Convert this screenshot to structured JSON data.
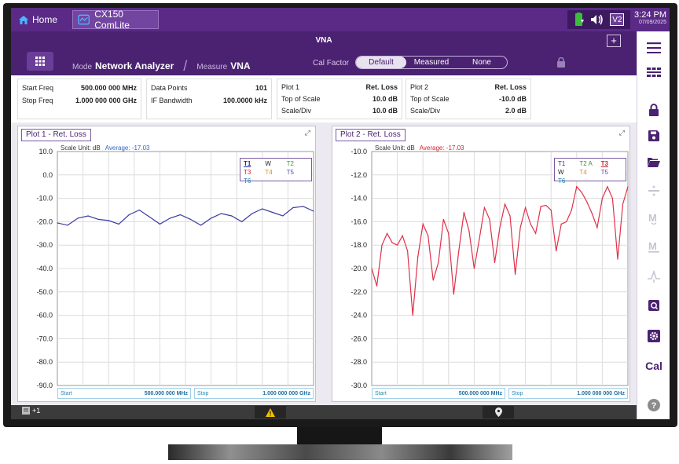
{
  "topbar": {
    "home_label": "Home",
    "app_tab_label": "CX150 ComLite",
    "status_v2": "V2",
    "time": "3:24 PM",
    "date": "07/09/2025"
  },
  "header": {
    "title": "VNA",
    "plus": "+",
    "mode_label": "Mode",
    "mode_value": "Network Analyzer",
    "measure_label": "Measure",
    "measure_value": "VNA",
    "cal_factor_label": "Cal Factor",
    "cal_options": [
      "Default",
      "Measured",
      "None"
    ],
    "cal_selected": "Default"
  },
  "info": {
    "freq": [
      {
        "label": "Start Freq",
        "value": "500.000 000 MHz"
      },
      {
        "label": "Stop Freq",
        "value": "1.000 000 000 GHz"
      }
    ],
    "sweep": [
      {
        "label": "Data Points",
        "value": "101"
      },
      {
        "label": "IF Bandwidth",
        "value": "100.0000 kHz"
      }
    ],
    "plot1": [
      {
        "label": "Plot 1",
        "value": "Ret. Loss"
      },
      {
        "label": "Top of Scale",
        "value": "10.0 dB"
      },
      {
        "label": "Scale/Div",
        "value": "10.0 dB"
      }
    ],
    "plot2": [
      {
        "label": "Plot 2",
        "value": "Ret. Loss"
      },
      {
        "label": "Top of Scale",
        "value": "-10.0 dB"
      },
      {
        "label": "Scale/Div",
        "value": "2.0 dB"
      }
    ]
  },
  "plot1": {
    "title": "Plot 1 - Ret. Loss",
    "scale_unit": "Scale Unit: dB",
    "average": "Average: -17.03",
    "legend": [
      {
        "text": "T1",
        "color": "#1e2fa0",
        "underline": true
      },
      {
        "text": "W",
        "color": "#222222"
      },
      {
        "text": "T2",
        "color": "#2e9a3a"
      },
      {
        "text": "T3",
        "color": "#d8202e"
      },
      {
        "text": "T4",
        "color": "#e08a1a"
      },
      {
        "text": "T5",
        "color": "#5a4ab0"
      },
      {
        "text": "T6",
        "color": "#1a8ab0"
      }
    ],
    "start_label": "Start",
    "start_value": "500.000 000 MHz",
    "stop_label": "Stop",
    "stop_value": "1.000 000 000 GHz"
  },
  "plot2": {
    "title": "Plot 2 - Ret. Loss",
    "scale_unit": "Scale Unit: dB",
    "average": "Average: -17.03",
    "legend": [
      {
        "text": "T1",
        "color": "#1e2fa0"
      },
      {
        "text": "T2 A",
        "color": "#2e9a3a"
      },
      {
        "text": "T3",
        "color": "#d8202e",
        "underline": true
      },
      {
        "text": "W",
        "color": "#222222"
      },
      {
        "text": "T4",
        "color": "#e08a1a"
      },
      {
        "text": "T5",
        "color": "#5a4ab0"
      },
      {
        "text": "T6",
        "color": "#1a8ab0"
      }
    ],
    "start_label": "Start",
    "start_value": "500.000 000 MHz",
    "stop_label": "Stop",
    "stop_value": "1.000 000 000 GHz"
  },
  "bottombar": {
    "notes": "+1"
  },
  "rightbar": {
    "cal": "Cal"
  },
  "chart_data": [
    {
      "type": "line",
      "title": "Plot 1 - Ret. Loss",
      "ylabel": "Scale Unit: dB",
      "ylim": [
        -90,
        10
      ],
      "yticks": [
        "10.0",
        "0.0",
        "-10.0",
        "-20.0",
        "-30.0",
        "-40.0",
        "-50.0",
        "-60.0",
        "-70.0",
        "-80.0",
        "-90.0"
      ],
      "xlim": [
        500,
        1000
      ],
      "xunit": "MHz",
      "grid": true,
      "legend_position": "top-right",
      "series": [
        {
          "name": "T1",
          "color": "#3a3aa0",
          "x": [
            500,
            520,
            540,
            560,
            580,
            600,
            620,
            640,
            660,
            680,
            700,
            720,
            740,
            760,
            780,
            800,
            820,
            840,
            860,
            880,
            900,
            920,
            940,
            960,
            980,
            1000
          ],
          "y": [
            -20.5,
            -21.5,
            -18.5,
            -17.5,
            -19,
            -19.5,
            -21,
            -17,
            -15,
            -18,
            -21,
            -18.5,
            -17,
            -19,
            -21.5,
            -18.5,
            -16.5,
            -17.5,
            -20,
            -16.5,
            -14.5,
            -16,
            -17.5,
            -14,
            -13.5,
            -15.5
          ]
        }
      ]
    },
    {
      "type": "line",
      "title": "Plot 2 - Ret. Loss",
      "ylabel": "Scale Unit: dB",
      "ylim": [
        -30,
        -10
      ],
      "yticks": [
        "-10.0",
        "-12.0",
        "-14.0",
        "-16.0",
        "-18.0",
        "-20.0",
        "-22.0",
        "-24.0",
        "-26.0",
        "-28.0",
        "-30.0"
      ],
      "xlim": [
        500,
        1000
      ],
      "xunit": "MHz",
      "grid": true,
      "legend_position": "top-right",
      "series": [
        {
          "name": "T3",
          "color": "#e0304a",
          "x": [
            500,
            510,
            520,
            530,
            540,
            550,
            560,
            570,
            580,
            590,
            600,
            610,
            620,
            630,
            640,
            650,
            660,
            670,
            680,
            690,
            700,
            710,
            720,
            730,
            740,
            750,
            760,
            770,
            780,
            790,
            800,
            810,
            820,
            830,
            840,
            850,
            860,
            870,
            880,
            890,
            900,
            910,
            920,
            930,
            940,
            950,
            960,
            970,
            980,
            990,
            1000
          ],
          "y": [
            -20,
            -21.5,
            -18,
            -17,
            -17.8,
            -18,
            -17.2,
            -18.5,
            -24,
            -19,
            -16.2,
            -17.2,
            -21,
            -19.5,
            -15.8,
            -17,
            -22.2,
            -18.5,
            -15.2,
            -16.8,
            -20,
            -17.5,
            -14.8,
            -15.8,
            -19.5,
            -16.5,
            -14.5,
            -15.5,
            -20.5,
            -16.5,
            -14.8,
            -16.2,
            -17,
            -14.7,
            -14.6,
            -15,
            -18.5,
            -16.2,
            -16,
            -15,
            -13,
            -13.5,
            -14.3,
            -15.3,
            -16.5,
            -14,
            -13,
            -14,
            -19.2,
            -14.5,
            -13
          ]
        }
      ]
    }
  ]
}
